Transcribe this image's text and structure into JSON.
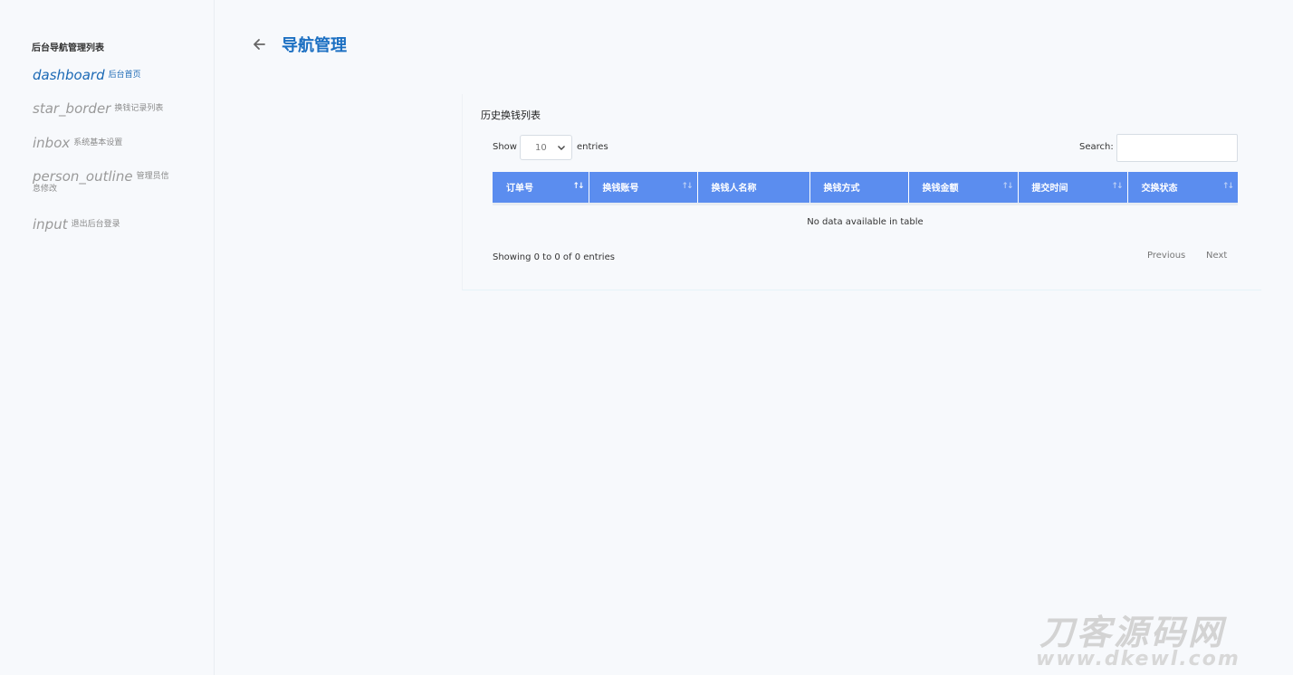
{
  "sidebar": {
    "title": "后台导航管理列表",
    "items": [
      {
        "icon": "dashboard",
        "label": "后台首页",
        "active": true
      },
      {
        "icon": "star_border",
        "label": "换钱记录列表",
        "active": false
      },
      {
        "icon": "inbox",
        "label": "系统基本设置",
        "active": false
      },
      {
        "icon": "person_outline",
        "label": "管理员信息修改",
        "active": false
      },
      {
        "icon": "input",
        "label": "退出后台登录",
        "active": false
      }
    ]
  },
  "header": {
    "back_icon": "arrow-left-icon",
    "title": "导航管理"
  },
  "card": {
    "title": "历史换钱列表",
    "length": {
      "show_label": "Show",
      "selected": "10",
      "entries_label": "entries"
    },
    "search": {
      "label": "Search:",
      "value": ""
    },
    "table": {
      "columns": [
        "订单号",
        "换钱账号",
        "换钱人名称",
        "换钱方式",
        "换钱金额",
        "提交时间",
        "交换状态"
      ],
      "empty_text": "No data available in table"
    },
    "info": "Showing 0 to 0 of 0 entries",
    "pagination": {
      "previous": "Previous",
      "next": "Next"
    }
  },
  "watermark": {
    "line1": "刀客源码网",
    "line2": "www.dkewl.com"
  },
  "colors": {
    "accent": "#1b6fc2",
    "table_header": "#5b8def"
  }
}
